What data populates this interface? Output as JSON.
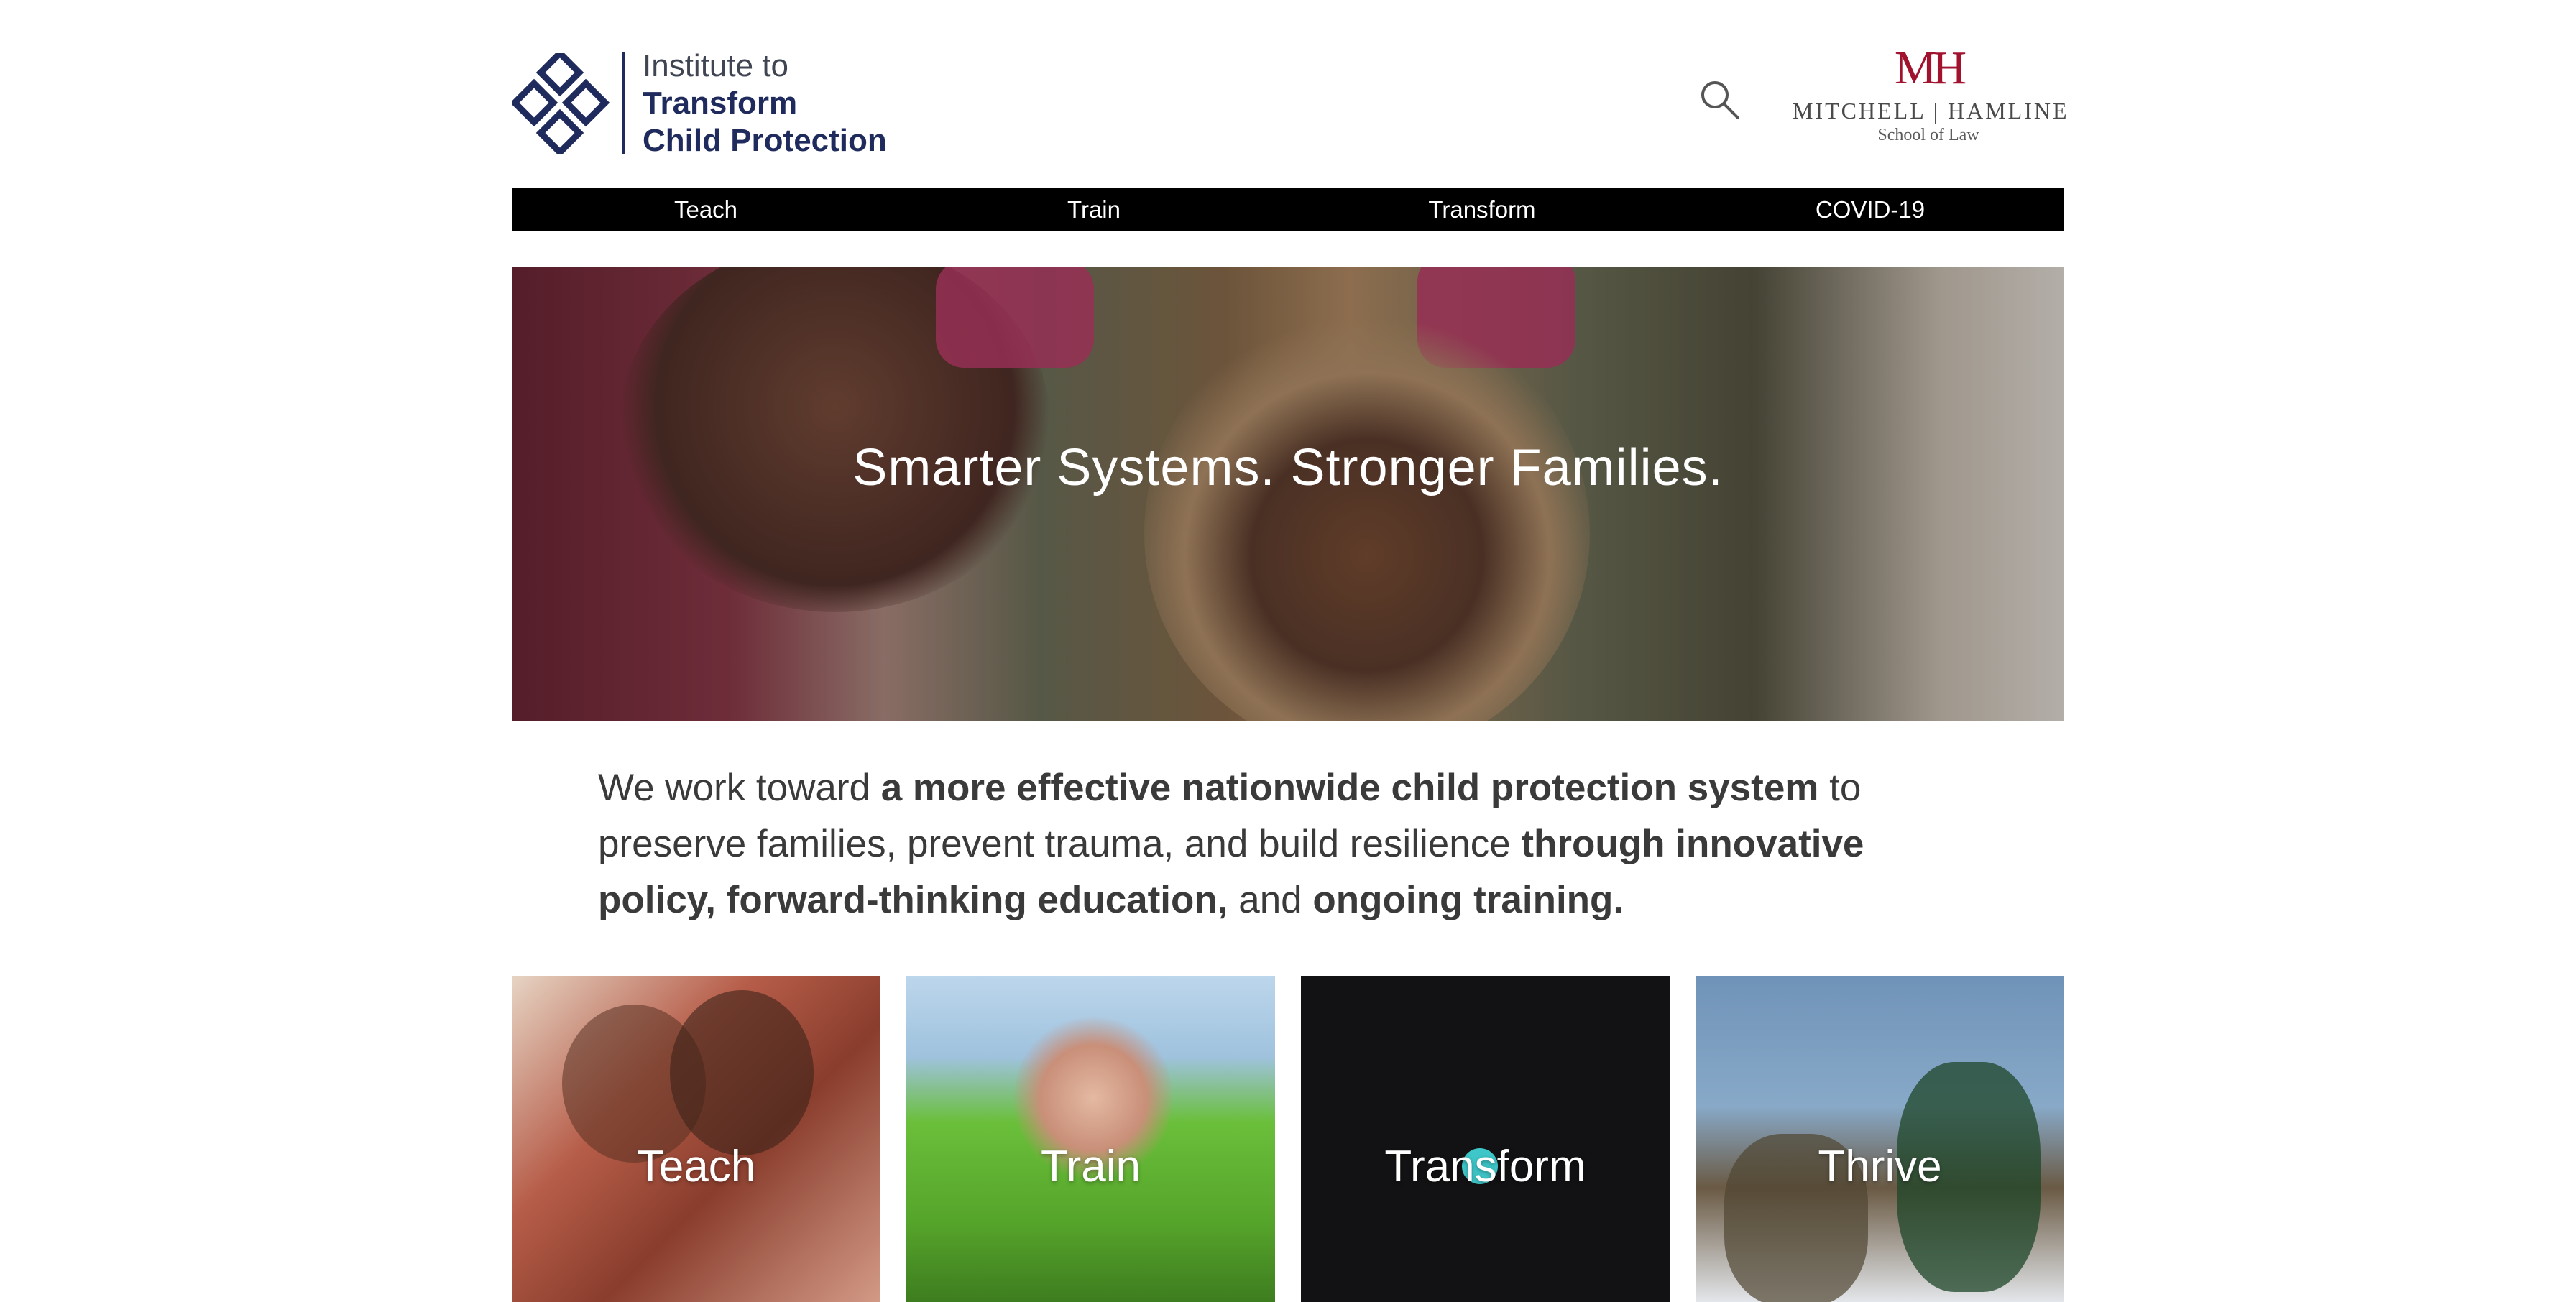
{
  "header": {
    "logo": {
      "line1": "Institute to",
      "line2": "Transform",
      "line3": "Child Protection"
    },
    "search_icon": "search-icon",
    "partner_logo": {
      "mark": "MH",
      "name": "MITCHELL | HAMLINE",
      "sub": "School of Law"
    }
  },
  "nav": {
    "items": [
      "Teach",
      "Train",
      "Transform",
      "COVID-19"
    ]
  },
  "hero": {
    "tagline": "Smarter Systems. Stronger Families."
  },
  "mission": {
    "p1": "We work toward ",
    "b1": "a more effective nationwide child protection system",
    "p2": " to preserve families, prevent trauma, and build resilience ",
    "b2": "through innovative policy, forward-thinking education,",
    "p3": " and ",
    "b3": "ongoing training."
  },
  "tiles": [
    {
      "label": "Teach"
    },
    {
      "label": "Train"
    },
    {
      "label": "Transform"
    },
    {
      "label": "Thrive"
    }
  ],
  "colors": {
    "brand_navy": "#1f2b5c",
    "partner_red": "#a1122e",
    "nav_bg": "#000000",
    "accent_teal": "#3ec6c8"
  }
}
